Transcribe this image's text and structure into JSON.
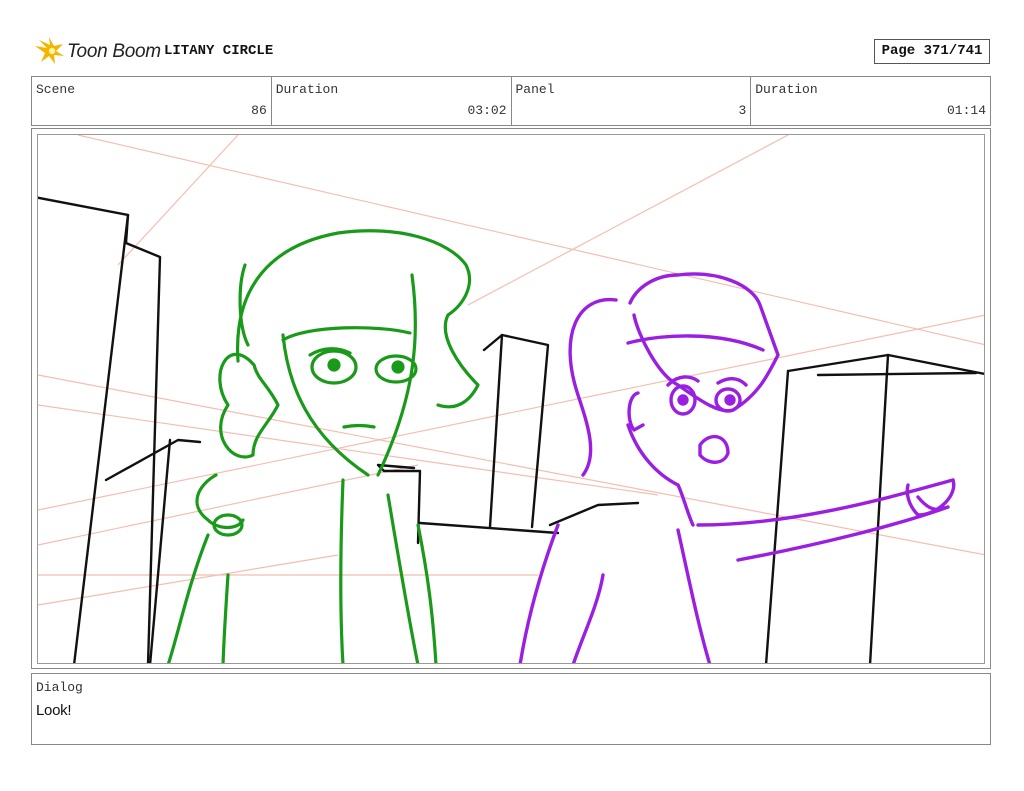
{
  "header": {
    "logo_text": "Toon Boom",
    "project_title": "LITANY CIRCLE",
    "page_label": "Page 371/741"
  },
  "info": [
    {
      "label": "Scene",
      "value": "86"
    },
    {
      "label": "Duration",
      "value": "03:02"
    },
    {
      "label": "Panel",
      "value": "3"
    },
    {
      "label": "Duration",
      "value": "01:14"
    }
  ],
  "panel": {
    "colors": {
      "buildings": "#111111",
      "perspective_guides": "#f2b8a8",
      "character_left": "#1a9a1a",
      "character_right": "#9b1fe0"
    }
  },
  "dialog": {
    "label": "Dialog",
    "text": "Look!"
  },
  "colors": {
    "logo_star": "#f5b400",
    "border": "#888888"
  }
}
